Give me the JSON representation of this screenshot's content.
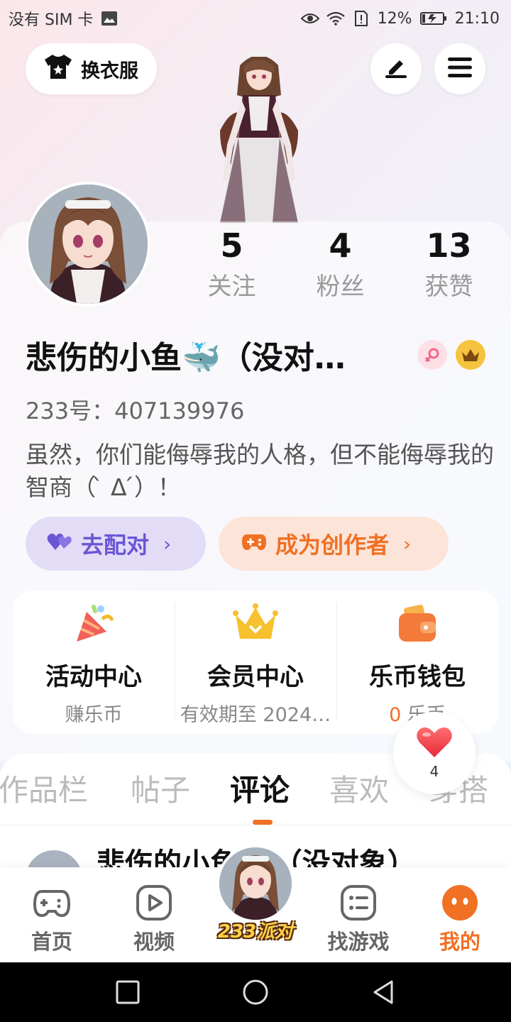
{
  "status_bar": {
    "carrier": "没有 SIM 卡",
    "battery_percent": "12%",
    "time": "21:10"
  },
  "header": {
    "outfit_label": "换衣服",
    "edit_icon": "edit-icon",
    "menu_icon": "menu-icon"
  },
  "profile": {
    "stats": [
      {
        "value": "5",
        "label": "关注"
      },
      {
        "value": "4",
        "label": "粉丝"
      },
      {
        "value": "13",
        "label": "获赞"
      }
    ],
    "username": "悲伤的小鱼🐳（没对…",
    "uid": "233号：407139976",
    "bio": "虽然，你们能侮辱我的人格，但不能侮辱我的智商（ ̀ Δ ́）！",
    "gender": "female",
    "match_label": "去配对",
    "creator_label": "成为创作者"
  },
  "services": [
    {
      "title": "活动中心",
      "sub": "赚乐币",
      "icon": "party-popper-icon"
    },
    {
      "title": "会员中心",
      "sub": "有效期至 2024…",
      "icon": "crown-icon"
    },
    {
      "title": "乐币钱包",
      "sub_amount": "0",
      "sub_unit": "乐币",
      "icon": "wallet-icon"
    }
  ],
  "like_bubble": {
    "count": "4"
  },
  "tabs": [
    "作品栏",
    "帖子",
    "评论",
    "喜欢",
    "穿搭"
  ],
  "active_tab": "评论",
  "comment_preview": {
    "name": "悲伤的小鱼🐳（没对象）"
  },
  "bottom_nav": [
    {
      "label": "首页",
      "icon": "gamepad-icon"
    },
    {
      "label": "视频",
      "icon": "play-icon"
    },
    {
      "label": "233派对",
      "icon": "party-avatar"
    },
    {
      "label": "找游戏",
      "icon": "game-list-icon"
    },
    {
      "label": "我的",
      "icon": "profile-face-icon",
      "active": true
    }
  ],
  "colors": {
    "accent": "#f07024",
    "match": "#6b55d6",
    "gold": "#f5b92e"
  }
}
